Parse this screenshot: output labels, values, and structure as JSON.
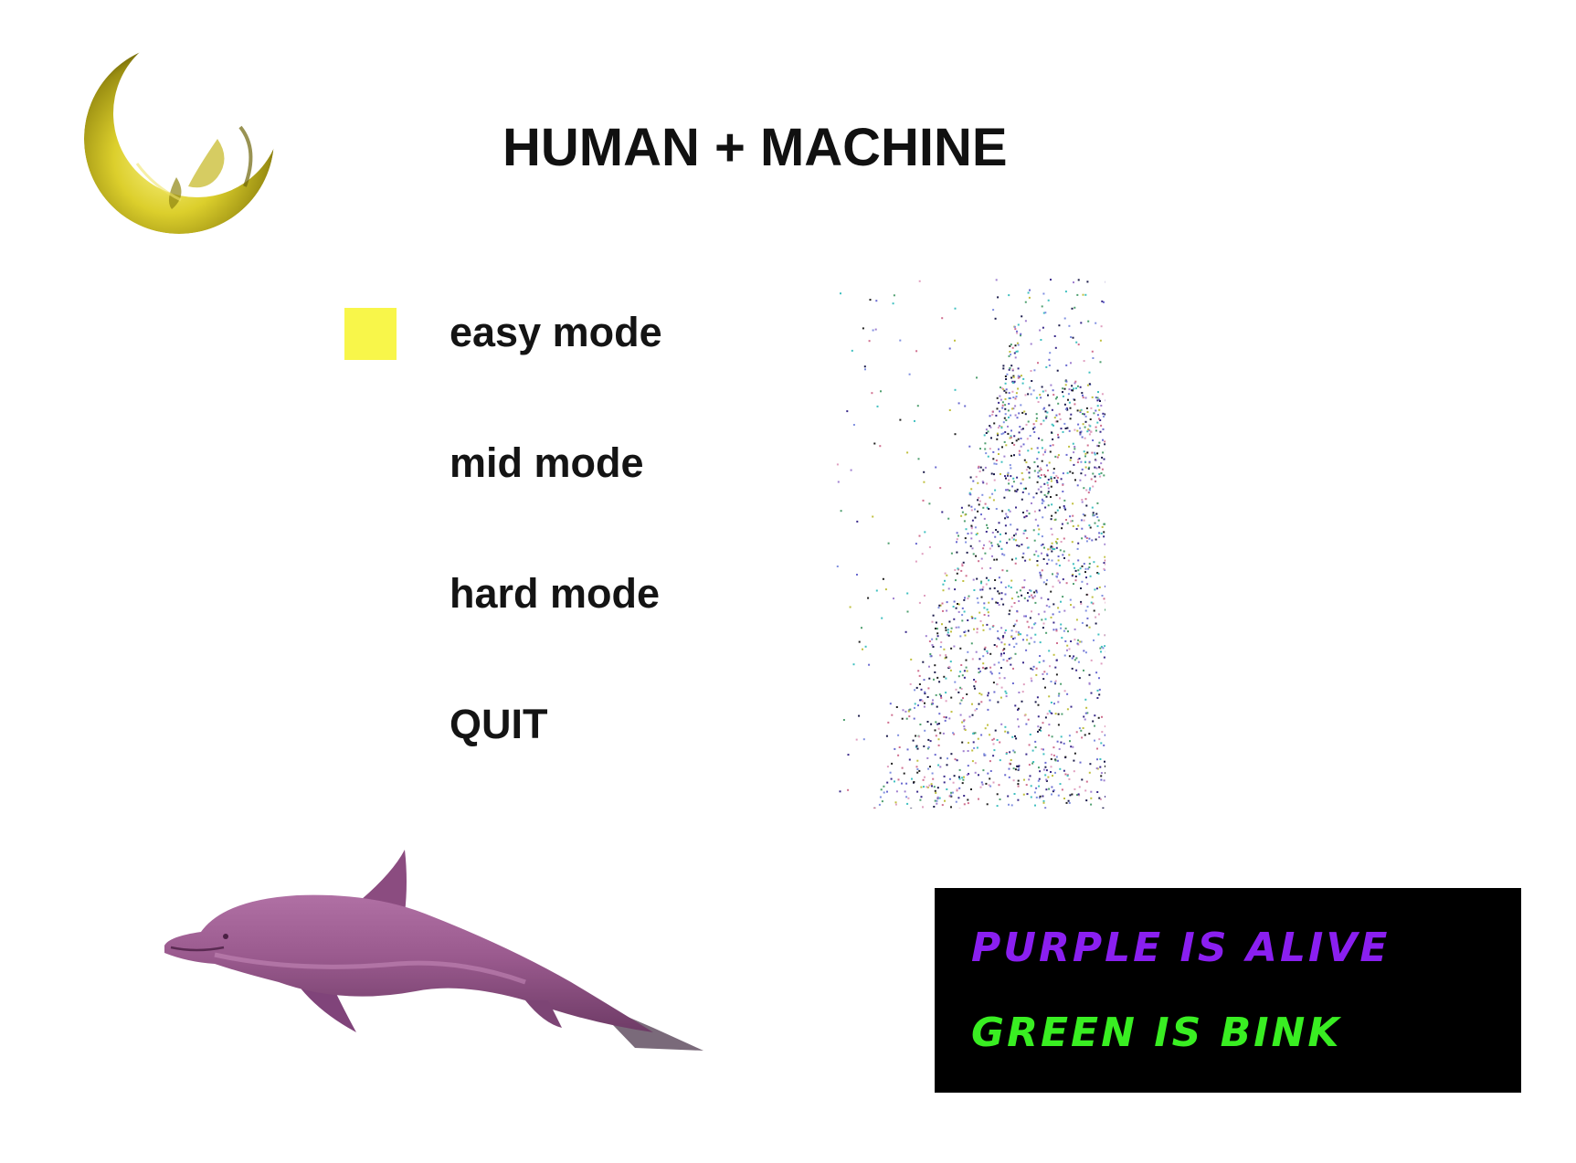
{
  "title": "HUMAN + MACHINE",
  "menu": {
    "items": [
      {
        "label": "easy mode",
        "selected": true
      },
      {
        "label": "mid mode",
        "selected": false
      },
      {
        "label": "hard mode",
        "selected": false
      },
      {
        "label": "QUIT",
        "selected": false
      }
    ],
    "selector_color": "#f8f64a"
  },
  "banner": {
    "line1": "PURPLE IS ALIVE",
    "line1_color": "#8a1ff0",
    "line2": "GREEN IS BINK",
    "line2_color": "#39ee22"
  },
  "images": {
    "moon": "crescent-moon-icon",
    "dolphin": "dolphin-icon",
    "noise": "static-noise-graphic"
  },
  "colors": {
    "moon": "#d8cc2a",
    "dolphin": "#9a5a8e"
  }
}
